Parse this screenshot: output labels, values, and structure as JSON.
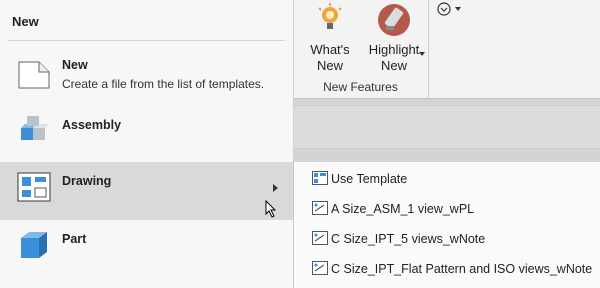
{
  "ribbon": {
    "buttons": [
      {
        "label_line1": "What's",
        "label_line2": "New"
      },
      {
        "label_line1": "Highlight",
        "label_line2": "New"
      }
    ],
    "group_label": "New Features"
  },
  "menu": {
    "title": "New",
    "items": [
      {
        "label": "New",
        "description": "Create a file from the list of templates."
      },
      {
        "label": "Assembly"
      },
      {
        "label": "Drawing"
      },
      {
        "label": "Part"
      }
    ]
  },
  "submenu": {
    "items": [
      {
        "label": "Use Template"
      },
      {
        "label": "A Size_ASM_1 view_wPL"
      },
      {
        "label": "C Size_IPT_5 views_wNote"
      },
      {
        "label": "C Size_IPT_Flat Pattern and ISO views_wNote"
      }
    ]
  },
  "colors": {
    "hover": "#d9d9d9",
    "cube_blue": "#3a8fd8",
    "cube_gray": "#b9c3cc"
  }
}
